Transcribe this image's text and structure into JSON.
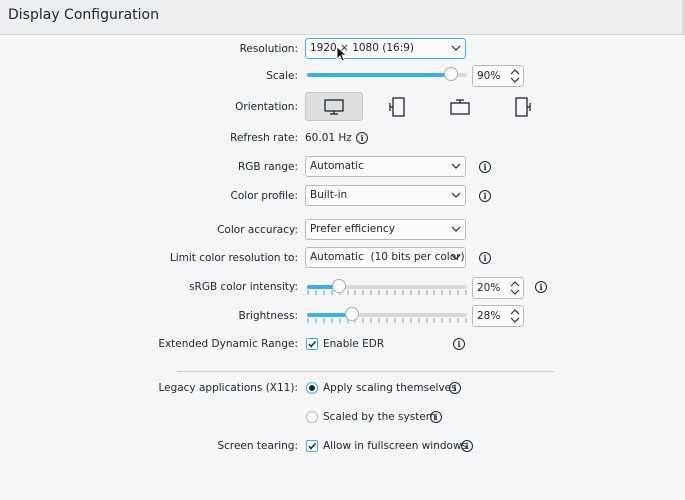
{
  "header": {
    "title": "Display Configuration"
  },
  "resolution": {
    "label": "Resolution:",
    "value": "1920 × 1080 (16:9)"
  },
  "scale": {
    "label": "Scale:",
    "level_percent": 90,
    "value": "90%"
  },
  "orientation": {
    "label": "Orientation:",
    "options": [
      "landscape",
      "portrait",
      "landscape-flipped",
      "portrait-flipped"
    ],
    "selected": "landscape"
  },
  "refresh": {
    "label": "Refresh rate:",
    "value": "60.01 Hz"
  },
  "rgb_range": {
    "label": "RGB range:",
    "value": "Automatic"
  },
  "color_profile": {
    "label": "Color profile:",
    "value": "Built-in"
  },
  "color_accuracy": {
    "label": "Color accuracy:",
    "value": "Prefer efficiency"
  },
  "color_resolution": {
    "label": "Limit color resolution to:",
    "value": "Automatic  (10 bits per color)"
  },
  "srgb_intensity": {
    "label": "sRGB color intensity:",
    "level_percent": 20,
    "value": "20%"
  },
  "brightness": {
    "label": "Brightness:",
    "level_percent": 28,
    "value": "28%"
  },
  "edr": {
    "label": "Extended Dynamic Range:",
    "option": "Enable EDR",
    "checked": true
  },
  "legacy": {
    "label": "Legacy applications (X11):",
    "option_apply": "Apply scaling themselves",
    "option_system": "Scaled by the system",
    "selected": "Apply scaling themselves"
  },
  "tearing": {
    "label": "Screen tearing:",
    "option": "Allow in fullscreen windows",
    "checked": true
  },
  "info_glyph": "i",
  "colors": {
    "accent": "#3daee9",
    "text": "#232629",
    "background": "#f5f6f7"
  }
}
